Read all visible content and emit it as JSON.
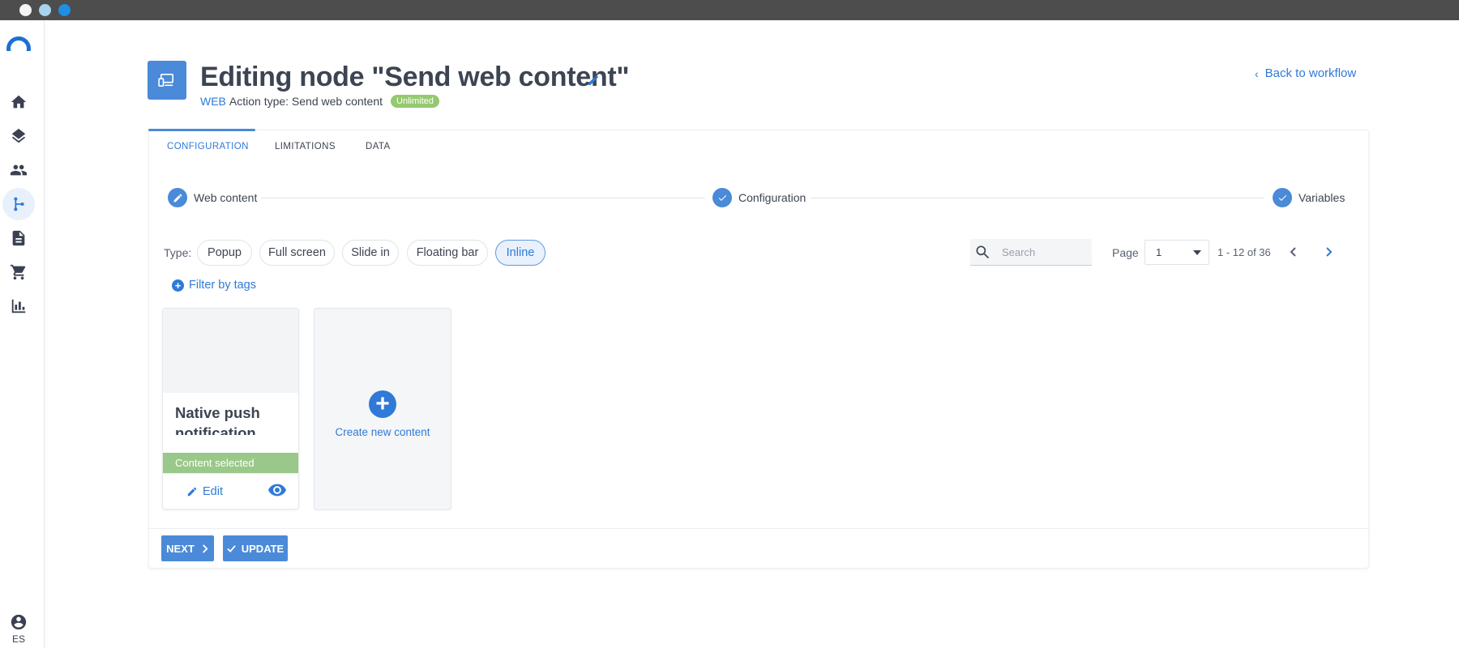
{
  "window": {
    "controls": [
      "close",
      "minimize",
      "maximize"
    ]
  },
  "sidebar": {
    "logo": "brand-logo",
    "items": [
      {
        "id": "home",
        "icon": "home-icon"
      },
      {
        "id": "layers",
        "icon": "layers-icon"
      },
      {
        "id": "people",
        "icon": "people-icon"
      },
      {
        "id": "workflow",
        "icon": "workflow-icon",
        "active": true
      },
      {
        "id": "documents",
        "icon": "document-icon"
      },
      {
        "id": "cart",
        "icon": "cart-icon"
      },
      {
        "id": "analytics",
        "icon": "bar-chart-icon"
      }
    ],
    "user_lang": "ES"
  },
  "header": {
    "title": "Editing node \"Send web content\"",
    "channel": "WEB",
    "action_type": "Action type: Send web content",
    "badge": "Unlimited",
    "back_link": "Back to workflow"
  },
  "tabs": [
    {
      "label": "CONFIGURATION",
      "active": true
    },
    {
      "label": "LIMITATIONS",
      "active": false
    },
    {
      "label": "DATA",
      "active": false
    }
  ],
  "stepper": [
    {
      "label": "Web content",
      "icon": "pencil-icon"
    },
    {
      "label": "Configuration",
      "icon": "check-icon"
    },
    {
      "label": "Variables",
      "icon": "check-icon"
    }
  ],
  "type_filter": {
    "label": "Type:",
    "options": [
      "Popup",
      "Full screen",
      "Slide in",
      "Floating bar",
      "Inline"
    ],
    "selected": "Inline"
  },
  "search": {
    "placeholder": "Search",
    "value": ""
  },
  "pagination": {
    "label": "Page",
    "current": "1",
    "range": "1 - 12 of 36"
  },
  "filter_by_tags": "Filter by tags",
  "content_items": [
    {
      "name": "Native push notification",
      "status": "Content selected",
      "edit_label": "Edit"
    }
  ],
  "create_new": "Create new content",
  "footer": {
    "next_label": "NEXT",
    "update_label": "UPDATE"
  },
  "colors": {
    "accent": "#2f7ad8",
    "button": "#4a8ad8",
    "badge_green": "#94c96f",
    "selected_green": "#9ac88a"
  }
}
